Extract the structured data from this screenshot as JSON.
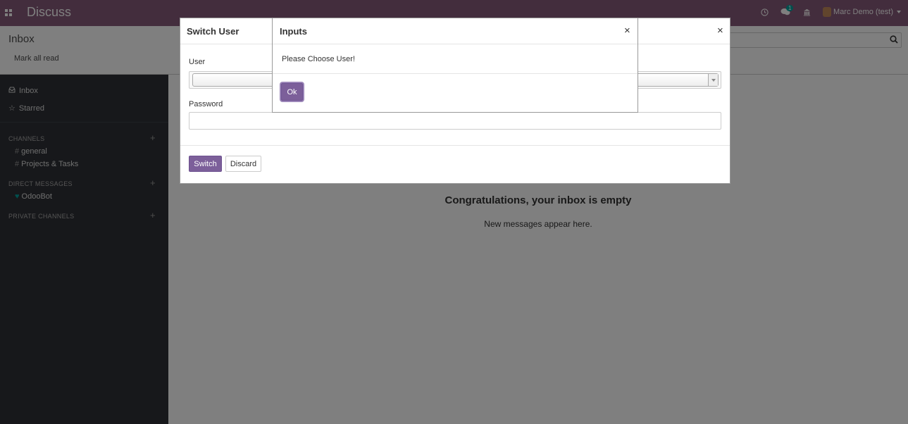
{
  "navbar": {
    "app_title": "Discuss",
    "user_name": "Marc Demo (test)",
    "chat_badge": "1",
    "apps_icon": "apps-grid-icon",
    "activity_icon": "clock-icon",
    "chat_icon": "chat-bubbles-icon",
    "company_icon": "bank-icon"
  },
  "control_panel": {
    "title": "Inbox",
    "mark_all_read": "Mark all read"
  },
  "sidebar": {
    "inbox": "Inbox",
    "starred": "Starred",
    "channels_header": "CHANNELS",
    "channels": [
      "general",
      "Projects & Tasks"
    ],
    "direct_header": "DIRECT MESSAGES",
    "direct": [
      "OdooBot"
    ],
    "private_header": "PRIVATE CHANNELS"
  },
  "main": {
    "empty_title": "Congratulations, your inbox is empty",
    "empty_sub": "New messages appear here."
  },
  "switch_user_dialog": {
    "title": "Switch User",
    "close": "×",
    "user_label": "User",
    "user_value": "",
    "password_label": "Password",
    "password_value": "",
    "switch_button": "Switch",
    "discard_button": "Discard"
  },
  "inputs_dialog": {
    "title": "Inputs",
    "close": "×",
    "message": "Please Choose User!",
    "ok_button": "Ok"
  },
  "colors": {
    "brand": "#875a7b",
    "primary_button": "#7c5f9a",
    "sidebar_bg": "#2f3136",
    "accent_teal": "#00a09d"
  }
}
